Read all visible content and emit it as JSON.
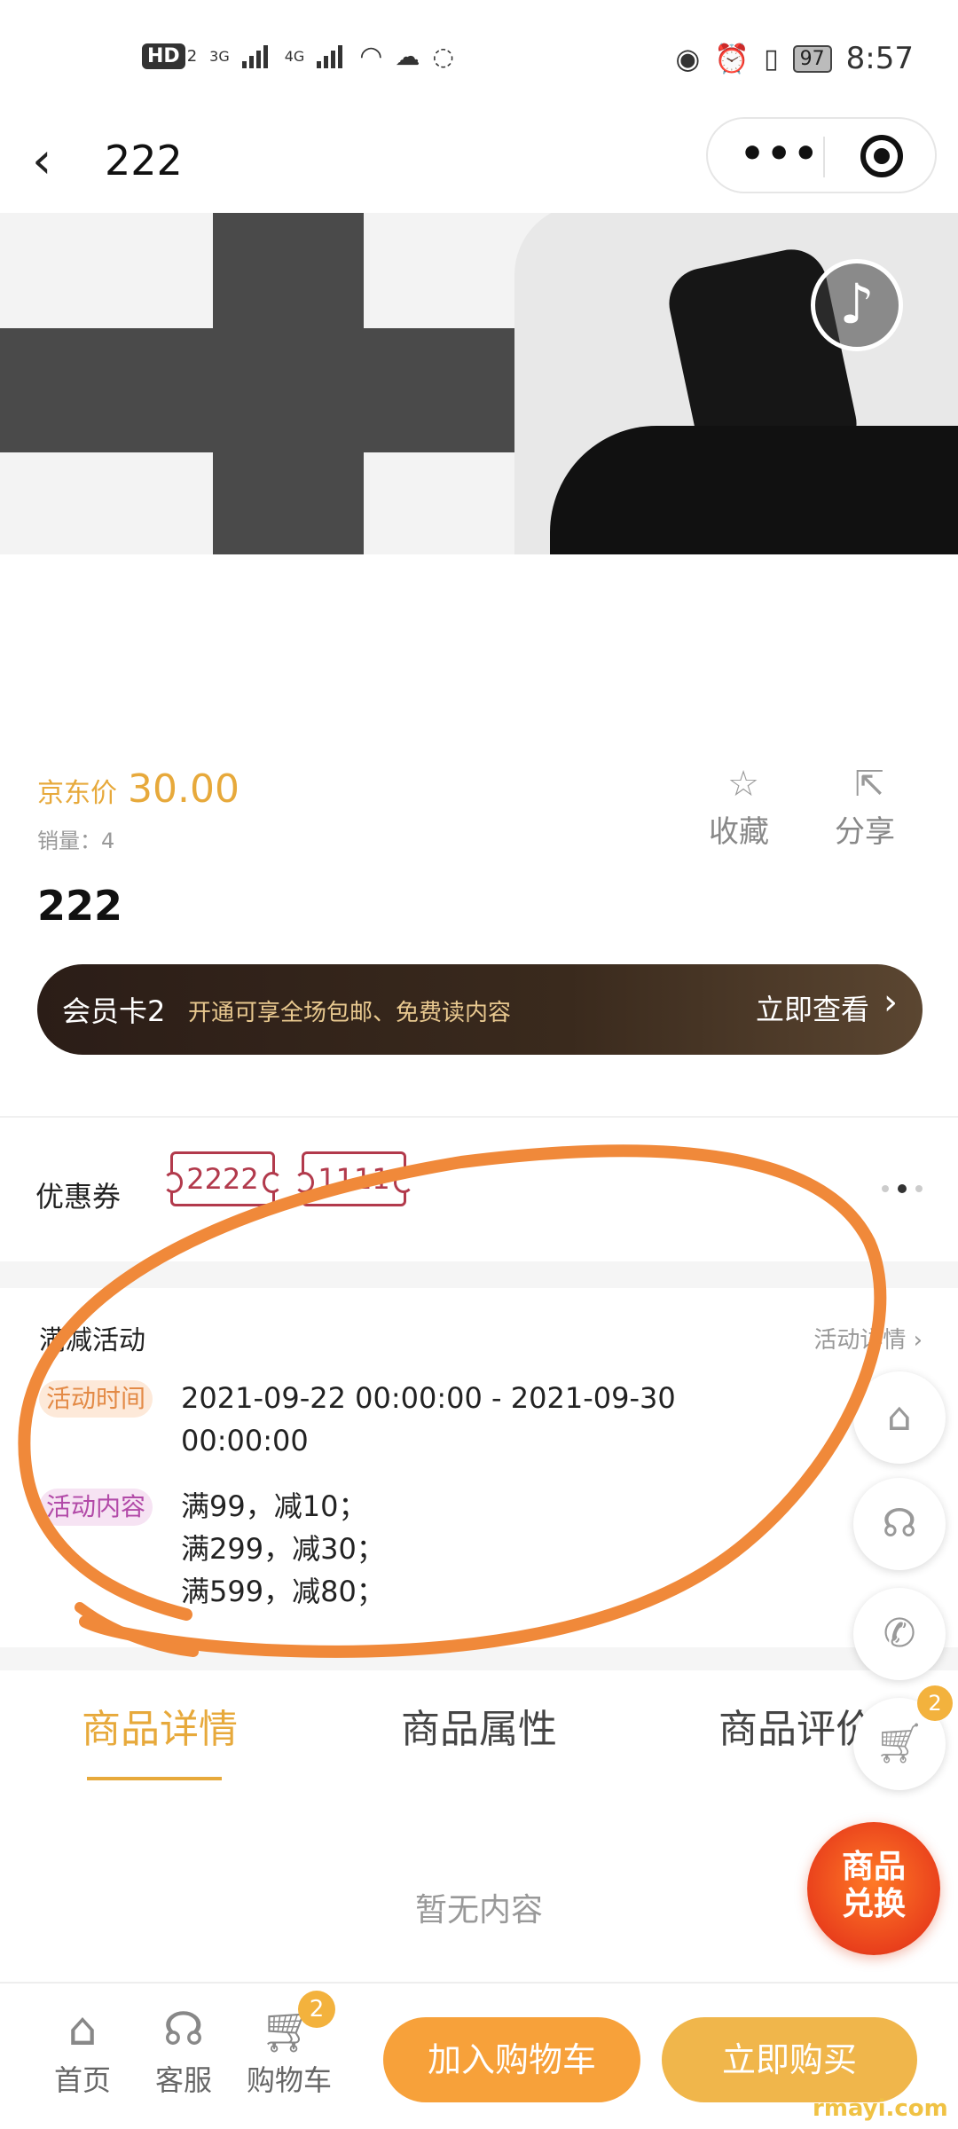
{
  "status_bar": {
    "hd_badge": "HD",
    "hd_sub": "2",
    "net1": "3G",
    "net2": "4G",
    "battery": "97",
    "time": "8:57"
  },
  "nav": {
    "back_icon": "chevron-left-icon",
    "title": "222",
    "more_icon": "more-dots-icon",
    "target_icon": "target-icon"
  },
  "banner": {
    "music_icon": "music-note-icon"
  },
  "product": {
    "price_label": "京东价",
    "price": "30.00",
    "sales": "销量：4",
    "name": "222",
    "favorite_label": "收藏",
    "share_label": "分享"
  },
  "member_card": {
    "name": "会员卡2",
    "desc": "开通可享全场包邮、免费读内容",
    "action": "立即查看"
  },
  "coupons": {
    "label": "优惠券",
    "items": [
      "2222",
      "1111"
    ]
  },
  "activity": {
    "title": "满减活动",
    "detail_link": "活动详情",
    "time_tag": "活动时间",
    "time_line1": "2021-09-22 00:00:00 - 2021-09-30",
    "time_line2": "00:00:00",
    "content_tag": "活动内容",
    "content_lines": [
      "满99，减10；",
      "满299，减30；",
      "满599，减80；"
    ]
  },
  "tabs": {
    "items": [
      "商品详情",
      "商品属性",
      "商品评价"
    ],
    "active": 0,
    "empty_text": "暂无内容"
  },
  "floating": {
    "cart_badge": "2",
    "exchange_line1": "商品",
    "exchange_line2": "兑换"
  },
  "bottom_bar": {
    "home": "首页",
    "service": "客服",
    "cart": "购物车",
    "cart_badge": "2",
    "add_to_cart": "加入购物车",
    "buy_now": "立即购买"
  },
  "watermark": "rmayi.com",
  "colors": {
    "accent": "#e7a93b",
    "coupon": "#b23a4c",
    "annotation": "#f0893a"
  }
}
